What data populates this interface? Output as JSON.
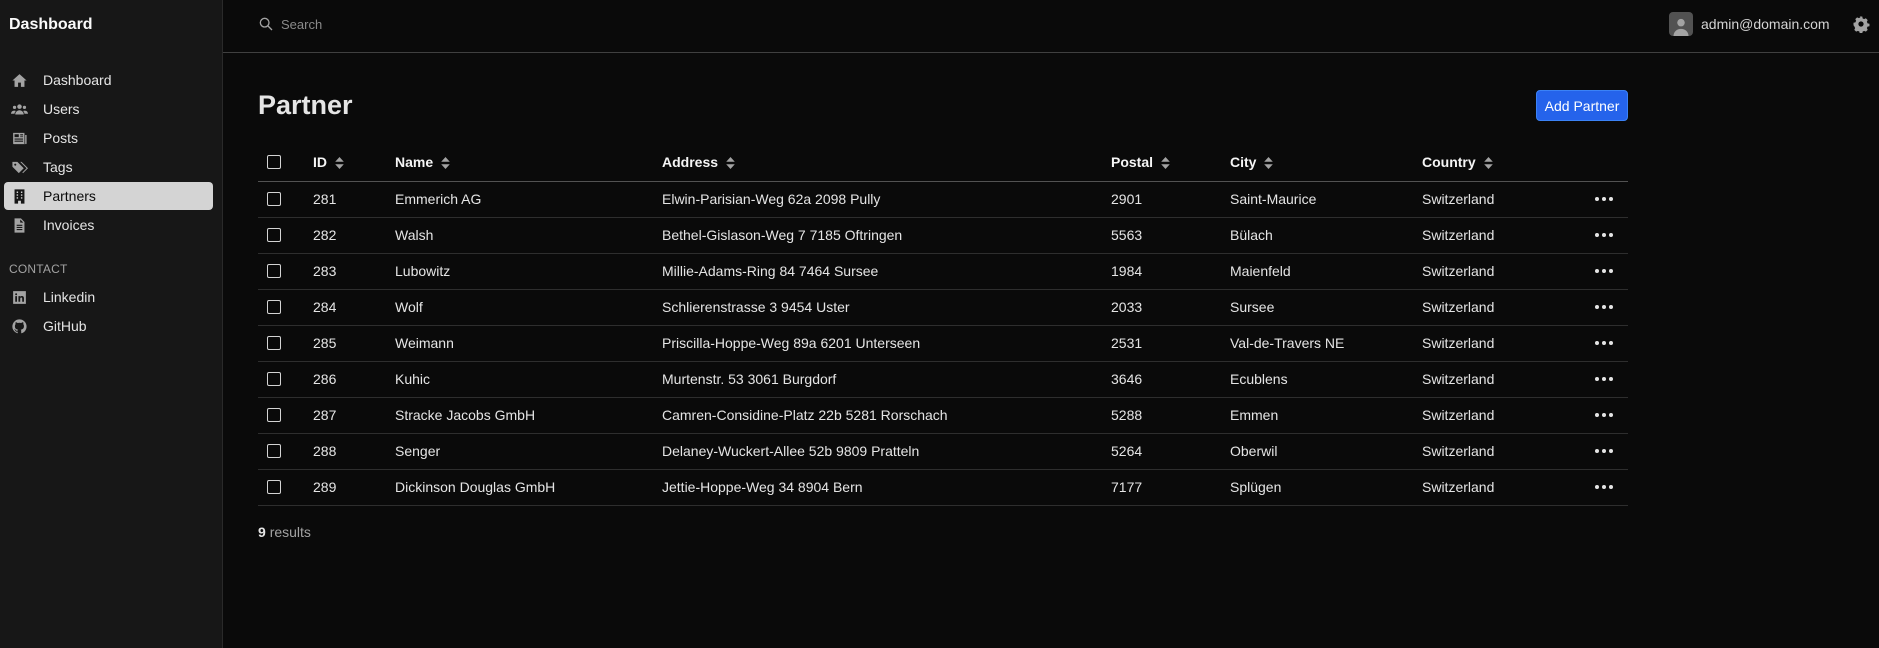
{
  "sidebar": {
    "brand": "Dashboard",
    "items": [
      {
        "label": "Dashboard",
        "icon": "home-icon"
      },
      {
        "label": "Users",
        "icon": "users-icon"
      },
      {
        "label": "Posts",
        "icon": "newspaper-icon"
      },
      {
        "label": "Tags",
        "icon": "tags-icon"
      },
      {
        "label": "Partners",
        "icon": "building-icon",
        "active": true
      },
      {
        "label": "Invoices",
        "icon": "document-icon"
      }
    ],
    "contact_label": "CONTACT",
    "contact_items": [
      {
        "label": "Linkedin",
        "icon": "linkedin-icon"
      },
      {
        "label": "GitHub",
        "icon": "github-icon"
      }
    ]
  },
  "topbar": {
    "search_placeholder": "Search",
    "user_email": "admin@domain.com"
  },
  "main": {
    "title": "Partner",
    "add_button": "Add Partner",
    "columns": [
      "ID",
      "Name",
      "Address",
      "Postal",
      "City",
      "Country"
    ],
    "rows": [
      {
        "id": "281",
        "name": "Emmerich AG",
        "address": "Elwin-Parisian-Weg 62a 2098 Pully",
        "postal": "2901",
        "city": "Saint-Maurice",
        "country": "Switzerland"
      },
      {
        "id": "282",
        "name": "Walsh",
        "address": "Bethel-Gislason-Weg 7 7185 Oftringen",
        "postal": "5563",
        "city": "Bülach",
        "country": "Switzerland"
      },
      {
        "id": "283",
        "name": "Lubowitz",
        "address": "Millie-Adams-Ring 84 7464 Sursee",
        "postal": "1984",
        "city": "Maienfeld",
        "country": "Switzerland"
      },
      {
        "id": "284",
        "name": "Wolf",
        "address": "Schlierenstrasse 3 9454 Uster",
        "postal": "2033",
        "city": "Sursee",
        "country": "Switzerland"
      },
      {
        "id": "285",
        "name": "Weimann",
        "address": "Priscilla-Hoppe-Weg 89a 6201 Unterseen",
        "postal": "2531",
        "city": "Val-de-Travers NE",
        "country": "Switzerland"
      },
      {
        "id": "286",
        "name": "Kuhic",
        "address": "Murtenstr. 53 3061 Burgdorf",
        "postal": "3646",
        "city": "Ecublens",
        "country": "Switzerland"
      },
      {
        "id": "287",
        "name": "Stracke Jacobs GmbH",
        "address": "Camren-Considine-Platz 22b 5281 Rorschach",
        "postal": "5288",
        "city": "Emmen",
        "country": "Switzerland"
      },
      {
        "id": "288",
        "name": "Senger",
        "address": "Delaney-Wuckert-Allee 52b 9809 Pratteln",
        "postal": "5264",
        "city": "Oberwil",
        "country": "Switzerland"
      },
      {
        "id": "289",
        "name": "Dickinson Douglas GmbH",
        "address": "Jettie-Hoppe-Weg 34 8904 Bern",
        "postal": "7177",
        "city": "Splügen",
        "country": "Switzerland"
      }
    ],
    "results_count": "9",
    "results_label": "results"
  },
  "colors": {
    "accent": "#2563eb",
    "active_nav": "#d4d4d4",
    "background": "#0a0a0a",
    "sidebar": "#171717"
  }
}
